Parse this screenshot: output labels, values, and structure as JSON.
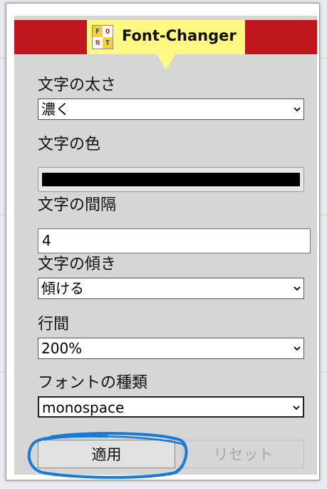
{
  "app": {
    "title": "Font-Changer",
    "logo_letters": [
      "F",
      "O",
      "N",
      "T"
    ]
  },
  "fields": {
    "weight": {
      "label": "文字の太さ",
      "value": "濃く"
    },
    "color": {
      "label": "文字の色",
      "value_hex": "#000000"
    },
    "spacing": {
      "label": "文字の間隔",
      "value": "4"
    },
    "slant": {
      "label": "文字の傾き",
      "value": "傾ける"
    },
    "line_height": {
      "label": "行間",
      "value": "200%"
    },
    "font_family": {
      "label": "フォントの種類",
      "value": "monospace"
    }
  },
  "buttons": {
    "apply": "適用",
    "reset": "リセット"
  },
  "colors": {
    "header_red": "#c0171f",
    "title_yellow": "#fff882",
    "panel_gray": "#d6d6d6",
    "annotation_blue": "#1a7ad6"
  }
}
